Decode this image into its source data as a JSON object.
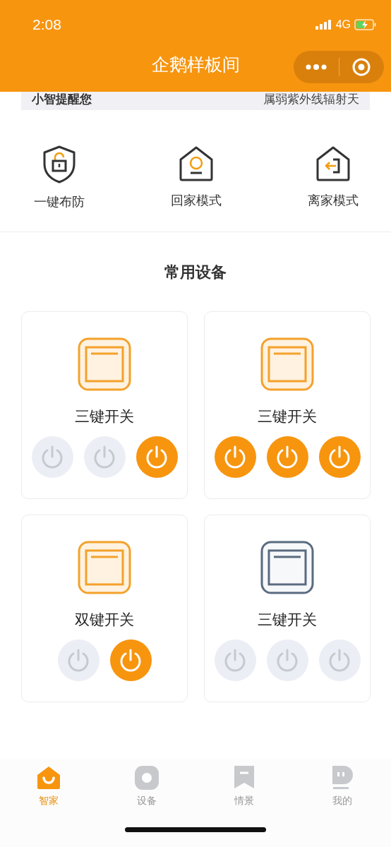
{
  "status_bar": {
    "time": "2:08",
    "network": "4G"
  },
  "nav": {
    "title": "企鹅样板间"
  },
  "notice": {
    "label": "小智提醒您",
    "text": "属弱紫外线辐射天"
  },
  "quick_actions": [
    {
      "kind": "shield",
      "label": "一键布防"
    },
    {
      "kind": "home",
      "label": "回家模式"
    },
    {
      "kind": "leave",
      "label": "离家模式"
    }
  ],
  "section_title": "常用设备",
  "devices": [
    {
      "name": "三键开关",
      "switches": [
        {
          "on": false
        },
        {
          "on": false
        },
        {
          "on": true
        }
      ]
    },
    {
      "name": "三键开关",
      "switches": [
        {
          "on": true
        },
        {
          "on": true
        },
        {
          "on": true
        }
      ]
    },
    {
      "name": "双键开关",
      "switches": [
        {
          "on": false
        },
        {
          "on": true
        }
      ]
    },
    {
      "name": "三键开关",
      "switches": [
        {
          "on": false
        },
        {
          "on": false
        },
        {
          "on": false
        }
      ]
    }
  ],
  "tabs": [
    {
      "kind": "home",
      "label": "智家",
      "selected": true
    },
    {
      "kind": "device",
      "label": "设备",
      "selected": false
    },
    {
      "kind": "scene",
      "label": "情景",
      "selected": false
    },
    {
      "kind": "me",
      "label": "我的",
      "selected": false
    }
  ]
}
